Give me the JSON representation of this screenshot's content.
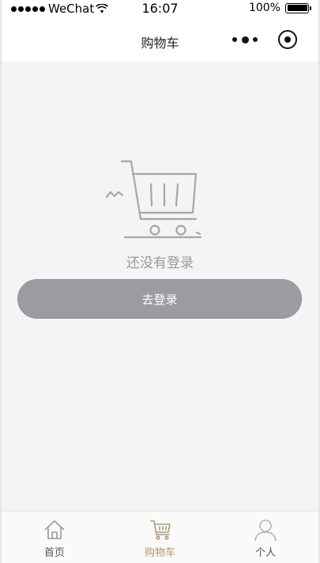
{
  "status_bar": {
    "carrier": "WeChat",
    "time": "16:07",
    "battery": "100%"
  },
  "nav": {
    "title": "购物车"
  },
  "main": {
    "empty_message": "还没有登录",
    "login_button": "去登录"
  },
  "tabbar": {
    "active_color": "#b09877",
    "items": [
      {
        "label": "首页",
        "icon": "home-icon"
      },
      {
        "label": "购物车",
        "icon": "cart-icon"
      },
      {
        "label": "个人",
        "icon": "person-icon"
      }
    ]
  }
}
